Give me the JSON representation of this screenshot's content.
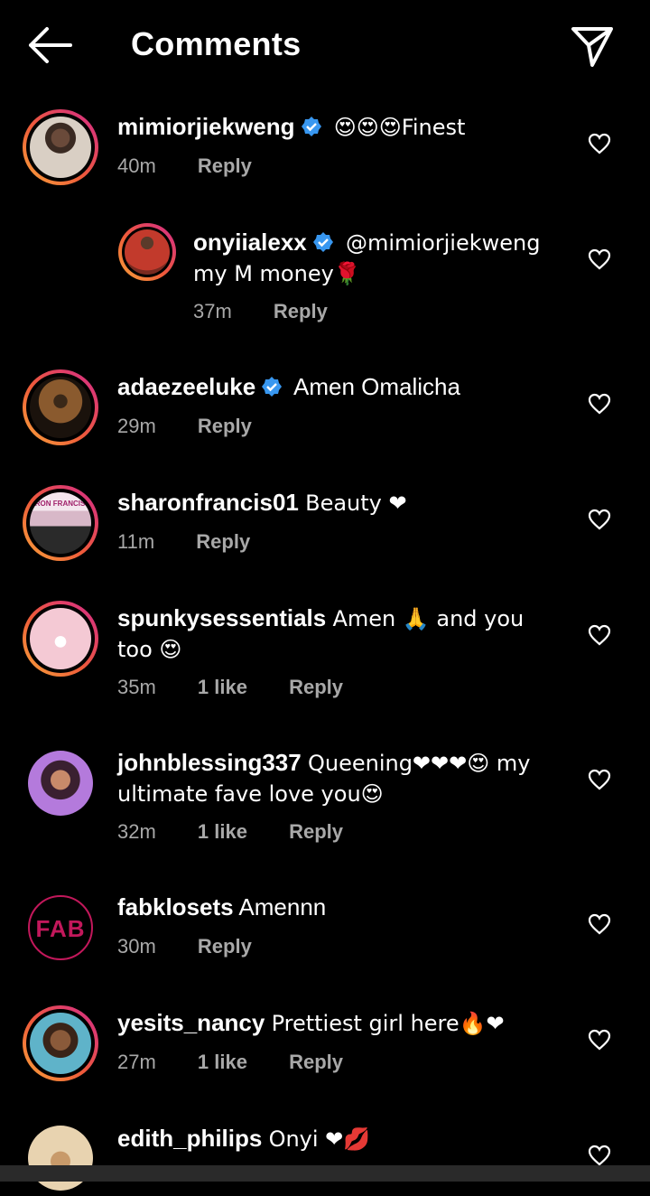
{
  "header": {
    "title": "Comments"
  },
  "comments": [
    {
      "username": "mimiorjiekweng",
      "verified": true,
      "text": "😍😍😍Finest",
      "time": "40m",
      "likes": "",
      "reply": "Reply",
      "avatar_colors": [
        "#d9cfc4",
        "#4a3a2e"
      ]
    },
    {
      "username": "onyiialexx",
      "verified": true,
      "text": "@mimiorjiekweng my M money🌹",
      "time": "37m",
      "likes": "",
      "reply": "Reply",
      "avatar_colors": [
        "#c23a2c",
        "#6b1f1a"
      ]
    },
    {
      "username": "adaezeeluke",
      "verified": true,
      "text": "Amen Omalicha",
      "time": "29m",
      "likes": "",
      "reply": "Reply",
      "avatar_colors": [
        "#8a5a2e",
        "#1a120c"
      ]
    },
    {
      "username": "sharonfrancis01",
      "verified": false,
      "text": "Beauty ❤",
      "time": "11m",
      "likes": "",
      "reply": "Reply",
      "avatar_text": "ARON FRANCIS T",
      "avatar_colors": [
        "#f4e6ee",
        "#2a2a2a"
      ]
    },
    {
      "username": "spunkysessentials",
      "verified": false,
      "text": "Amen 🙏 and you too 😍",
      "time": "35m",
      "likes": "1 like",
      "reply": "Reply",
      "avatar_colors": [
        "#f4c9d4",
        "#222"
      ]
    },
    {
      "username": "johnblessing337",
      "verified": false,
      "text": "Queening❤❤❤😍 my ultimate fave love you😍",
      "time": "32m",
      "likes": "1 like",
      "reply": "Reply",
      "avatar_colors": [
        "#b47adc",
        "#3a2030"
      ]
    },
    {
      "username": "fabklosets",
      "verified": false,
      "text": "Amennn",
      "time": "30m",
      "likes": "",
      "reply": "Reply",
      "avatar_text": "FAB",
      "avatar_colors": [
        "#000000",
        "#c2185b"
      ]
    },
    {
      "username": "yesits_nancy",
      "verified": false,
      "text": "Prettiest girl here🔥❤",
      "time": "27m",
      "likes": "1 like",
      "reply": "Reply",
      "avatar_colors": [
        "#5fb3c9",
        "#3a2418"
      ]
    },
    {
      "username": "edith_philips",
      "verified": false,
      "text": "Onyi ❤💋",
      "time": "",
      "likes": "",
      "reply": "",
      "avatar_colors": [
        "#e8d3b0",
        "#9a6a3a"
      ]
    }
  ]
}
